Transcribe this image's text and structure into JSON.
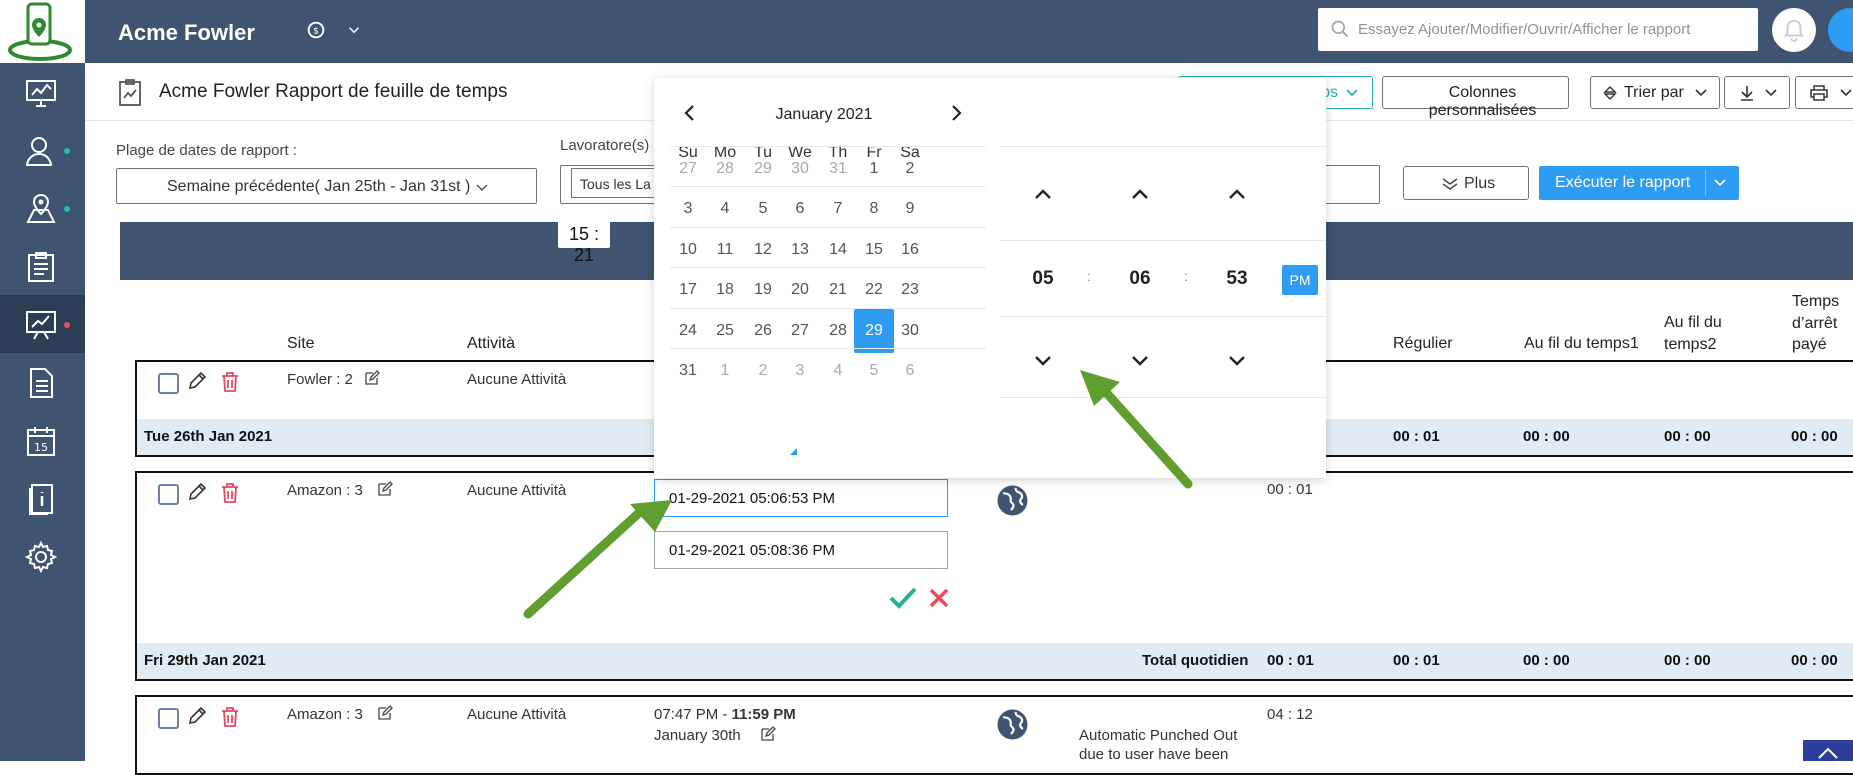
{
  "header": {
    "app_title": "Acme Fowler",
    "search_placeholder": "Essayez Ajouter/Modifier/Ouvrir/Afficher le rapport"
  },
  "sidebar": {
    "items": [
      {
        "icon": "monitor-chart-icon",
        "dot": null
      },
      {
        "icon": "user-icon",
        "dot": "#22c39a"
      },
      {
        "icon": "map-pin-icon",
        "dot": "#22c39a"
      },
      {
        "icon": "clipboard-list-icon",
        "dot": null
      },
      {
        "icon": "reports-chart-icon",
        "dot": "#e84a5f",
        "active": true
      },
      {
        "icon": "document-icon",
        "dot": null
      },
      {
        "icon": "calendar-icon",
        "dot": null
      },
      {
        "icon": "info-book-icon",
        "dot": null
      },
      {
        "icon": "gear-icon",
        "dot": null
      }
    ]
  },
  "report": {
    "title": "Acme Fowler Rapport de feuille de temps",
    "toolbar": {
      "timeline_label": "ps",
      "custom_columns_label": "Colonnes personnalisées",
      "sort_label": "Trier par"
    }
  },
  "filters": {
    "date_range_label": "Plage de dates de rapport :",
    "date_range_value": "Semaine précédente( Jan 25th - Jan 31st )",
    "workers_label": "Lavoratore(s)",
    "workers_value": "Tous les La",
    "more_label": "Plus",
    "run_label": "Exécuter le rapport"
  },
  "table": {
    "time_chip": "15 : 21",
    "headers": {
      "site": "Site",
      "activity": "Attività",
      "regular": "Régulier",
      "overtime1": "Au fil du temps1",
      "overtime2": "Au fil du temps2",
      "paid_break": "Temps d’arrêt payé"
    },
    "rows": [
      {
        "site": "Fowler : 2",
        "activity": "Aucune Attività"
      },
      {
        "site": "Amazon : 3",
        "activity": "Aucune Attività",
        "start_input": "01-29-2021 05:06:53 PM",
        "end_input": "01-29-2021 05:08:36 PM",
        "duration": "00 : 01"
      },
      {
        "site": "Amazon : 3",
        "activity": "Aucune Attività",
        "time_start": "07:47 PM",
        "time_sep": " - ",
        "time_end": "11:59 PM",
        "date": "January 30th",
        "duration": "04 : 12",
        "note_line1": "Automatic Punched Out",
        "note_line2": "due to user have been"
      }
    ],
    "day_totals": [
      {
        "day": "Tue 26th Jan 2021",
        "regular": "00 : 01",
        "ot1": "00 : 00",
        "ot2": "00 : 00",
        "paid": "00 : 00"
      },
      {
        "day": "Fri 29th Jan 2021",
        "total_label": "Total quotidien",
        "total": "00 : 01",
        "regular": "00 : 01",
        "ot1": "00 : 00",
        "ot2": "00 : 00",
        "paid": "00 : 00"
      }
    ]
  },
  "picker": {
    "month_label": "January 2021",
    "weekdays": [
      "Su",
      "Mo",
      "Tu",
      "We",
      "Th",
      "Fr",
      "Sa"
    ],
    "weeks": [
      [
        "27",
        "28",
        "29",
        "30",
        "31",
        "1",
        "2"
      ],
      [
        "3",
        "4",
        "5",
        "6",
        "7",
        "8",
        "9"
      ],
      [
        "10",
        "11",
        "12",
        "13",
        "14",
        "15",
        "16"
      ],
      [
        "17",
        "18",
        "19",
        "20",
        "21",
        "22",
        "23"
      ],
      [
        "24",
        "25",
        "26",
        "27",
        "28",
        "29",
        "30"
      ],
      [
        "31",
        "1",
        "2",
        "3",
        "4",
        "5",
        "6"
      ]
    ],
    "selected_day": "29",
    "time": {
      "hours": "05",
      "minutes": "06",
      "seconds": "53",
      "ampm": "PM",
      "separator": ":"
    }
  },
  "colors": {
    "navy": "#3e5470",
    "accent": "#2f9cf4",
    "danger": "#e84a5f",
    "success": "#2ab08e",
    "arrow": "#5f9e2f"
  }
}
